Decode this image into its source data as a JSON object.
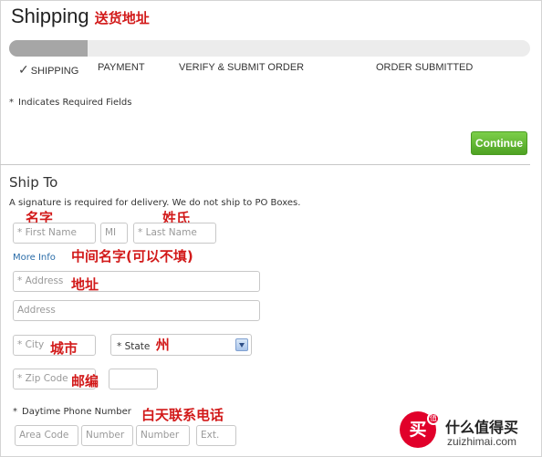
{
  "header": {
    "title": "Shipping",
    "title_cn": "送货地址"
  },
  "progress": {
    "value": 0.15,
    "steps": [
      {
        "label": "SHIPPING",
        "checked": true
      },
      {
        "label": "PAYMENT",
        "checked": false
      },
      {
        "label": "VERIFY & SUBMIT ORDER",
        "checked": false
      },
      {
        "label": "ORDER SUBMITTED",
        "checked": false
      }
    ],
    "check_icon": "checkmark-icon"
  },
  "required_note": "Indicates Required Fields",
  "continue_label": "Continue",
  "ship_to": {
    "heading": "Ship To",
    "notice": "A signature is required for delivery. We do not ship to PO Boxes.",
    "first_name": {
      "placeholder": "* First Name",
      "value": ""
    },
    "first_name_cn": "名字",
    "middle_initial": {
      "placeholder": "MI",
      "value": ""
    },
    "last_name": {
      "placeholder": "* Last Name",
      "value": ""
    },
    "last_name_cn": "姓氏",
    "more_info": "More Info",
    "middle_name_cn": "中间名字(可以不填)",
    "address1": {
      "placeholder": "* Address",
      "value": ""
    },
    "address_cn": "地址",
    "address2": {
      "placeholder": "Address",
      "value": ""
    },
    "city": {
      "placeholder": "* City",
      "value": ""
    },
    "city_cn": "城市",
    "state": {
      "selected": "* State"
    },
    "state_cn": "州",
    "zip": {
      "placeholder": "* Zip Code",
      "value": ""
    },
    "zip_cn": "邮编",
    "zip_ext": {
      "placeholder": "",
      "value": ""
    },
    "phone_label": "Daytime Phone Number",
    "phone_cn": "白天联系电话",
    "phone_area": {
      "placeholder": "Area Code",
      "value": ""
    },
    "phone_number1": {
      "placeholder": "Number",
      "value": ""
    },
    "phone_number2": {
      "placeholder": "Number",
      "value": ""
    },
    "phone_ext": {
      "placeholder": "Ext.",
      "value": ""
    }
  },
  "watermark": {
    "circle_glyph": "买",
    "badge": "值",
    "text": "什么值得买",
    "url": "zuizhimai.com"
  },
  "colors": {
    "continue_button": "#5cb82f",
    "progress_fill": "#a6a6a6",
    "link": "#2a6ca8",
    "annotation": "#d21a1a",
    "watermark": "#e1002a"
  }
}
